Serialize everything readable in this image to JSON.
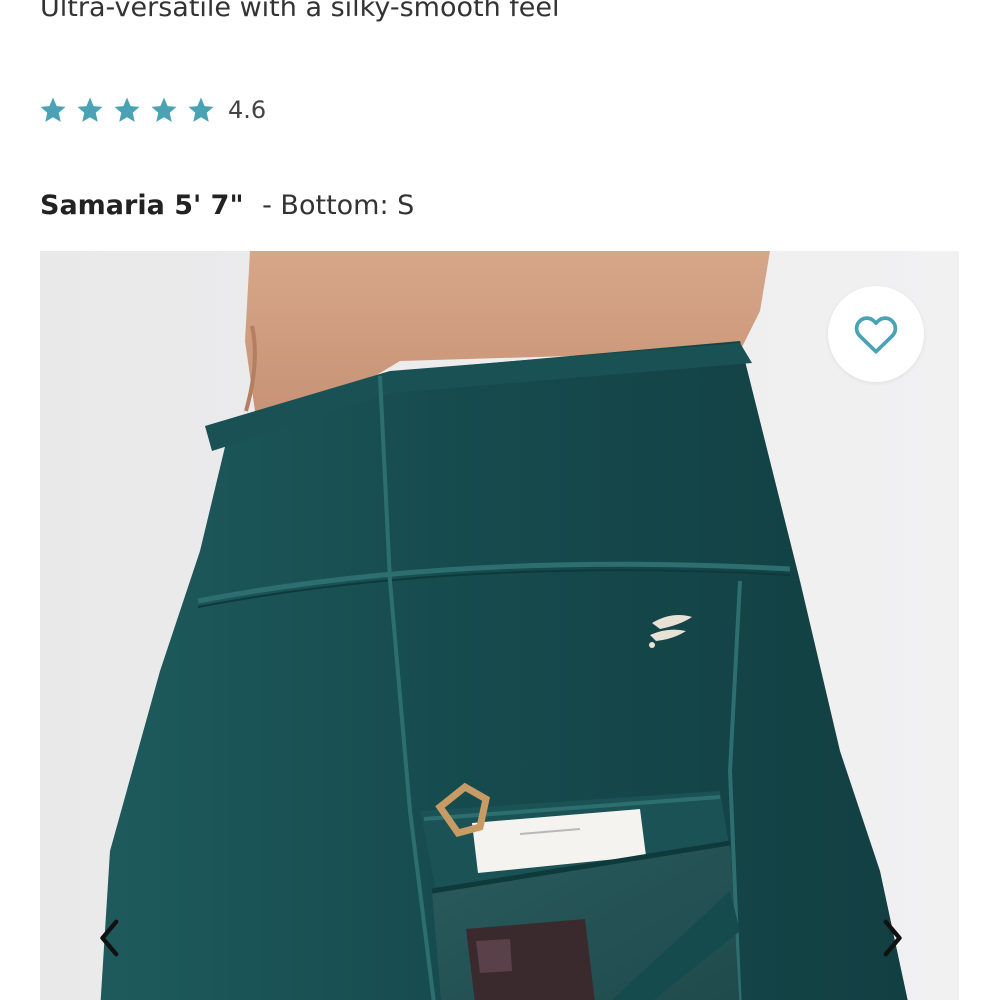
{
  "product": {
    "subtitle": "Ultra-versatile with a silky-smooth feel",
    "rating": {
      "stars": 5,
      "value": "4.6",
      "star_color": "#4aa3b5"
    },
    "model": {
      "name": "Samaria 5' 7\"",
      "size": "- Bottom: S"
    }
  },
  "gallery": {
    "favorite_icon": "heart-icon",
    "prev_icon": "chevron-left-icon",
    "next_icon": "chevron-right-icon",
    "accent_color": "#4aa3b5",
    "fabric_color": "#164b4e"
  }
}
